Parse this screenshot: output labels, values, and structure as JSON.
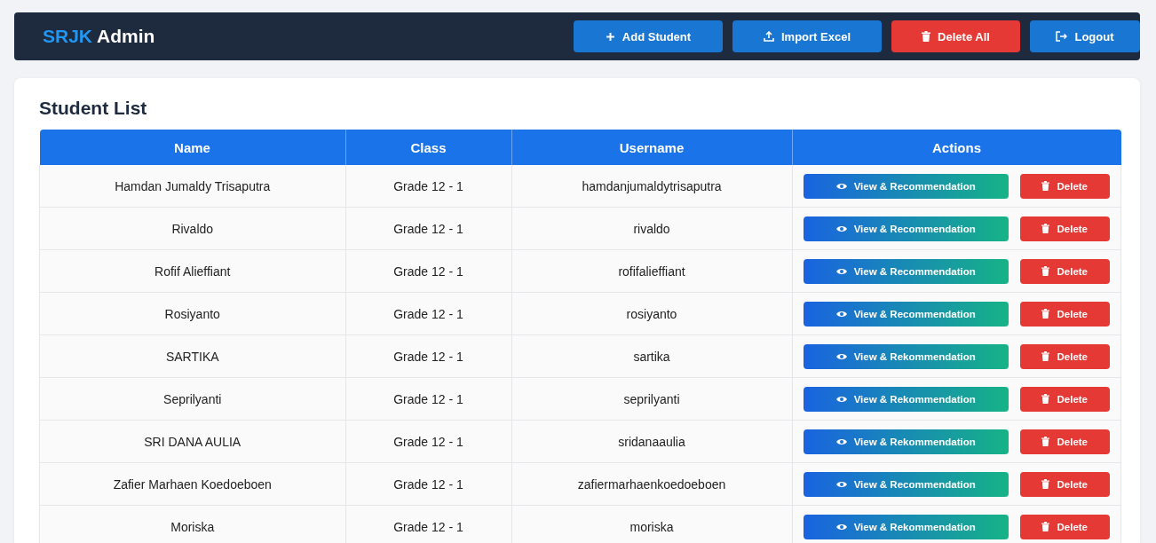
{
  "navbar": {
    "brand": {
      "highlight": "SRJK",
      "rest": "Admin"
    },
    "buttons": [
      {
        "label": "Add Student",
        "kind": "add"
      },
      {
        "label": "Import Excel",
        "kind": "import"
      },
      {
        "label": "Delete All",
        "kind": "delete"
      },
      {
        "label": "Logout",
        "kind": "logout"
      }
    ]
  },
  "card": {
    "title": "Student List",
    "table": {
      "columns": [
        "Name",
        "Class",
        "Username",
        "Actions"
      ],
      "rows": [
        {
          "name": "Hamdan Jumaldy Trisaputra",
          "class": "Grade 12 - 1",
          "username": "hamdanjumaldytrisaputra",
          "actions": [
            "View & Recommendation",
            "Delete"
          ]
        },
        {
          "name": "Rivaldo",
          "class": "Grade 12 - 1",
          "username": "rivaldo",
          "actions": [
            "View & Recommendation",
            "Delete"
          ]
        },
        {
          "name": "Rofif Alieffiant",
          "class": "Grade 12 - 1",
          "username": "rofifalieffiant",
          "actions": [
            "View & Recommendation",
            "Delete"
          ]
        },
        {
          "name": "Rosiyanto",
          "class": "Grade 12 - 1",
          "username": "rosiyanto",
          "actions": [
            "View & Recommendation",
            "Delete"
          ]
        },
        {
          "name": "SARTIKA",
          "class": "Grade 12 - 1",
          "username": "sartika",
          "actions": [
            "View & Rekommendation",
            "Delete"
          ]
        },
        {
          "name": "Seprilyanti",
          "class": "Grade 12 - 1",
          "username": "seprilyanti",
          "actions": [
            "View & Rekommendation",
            "Delete"
          ]
        },
        {
          "name": "SRI DANA AULIA",
          "class": "Grade 12 - 1",
          "username": "sridanaaulia",
          "actions": [
            "View & Rekommendation",
            "Delete"
          ]
        },
        {
          "name": "Zafier Marhaen Koedoeboen",
          "class": "Grade 12 - 1",
          "username": "zafiermarhaenkoedoeboen",
          "actions": [
            "View & Recommendation",
            "Delete"
          ]
        },
        {
          "name": "Moriska",
          "class": "Grade 12 - 1",
          "username": "moriska",
          "actions": [
            "View & Rekommendation",
            "Delete"
          ]
        }
      ]
    }
  }
}
